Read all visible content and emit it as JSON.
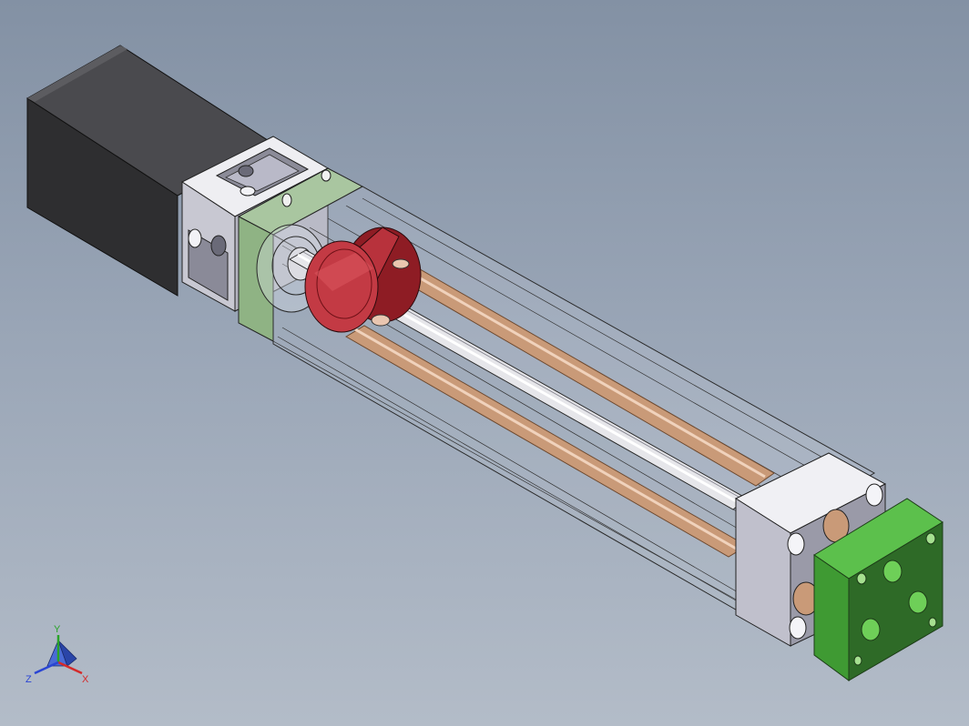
{
  "triad": {
    "x_label": "X",
    "y_label": "Y",
    "z_label": "Z",
    "x_color": "#d42a2a",
    "y_color": "#29a329",
    "z_color": "#2a45d4"
  },
  "colors": {
    "motor": "#3d3d3d",
    "bracket": "#d6d6de",
    "carriage": "#b8323c",
    "guide_rod": "#c99a78",
    "screw": "#e8e8ec",
    "end_plate": "#4caf3f"
  }
}
